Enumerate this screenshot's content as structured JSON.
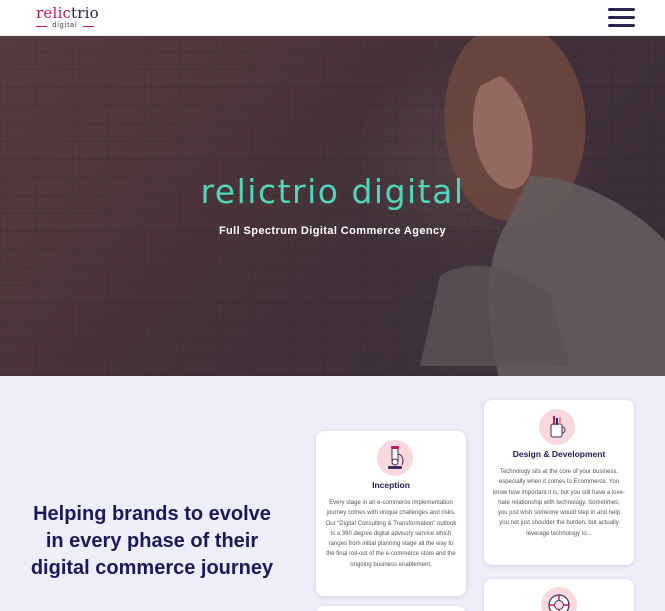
{
  "header": {
    "logo": {
      "word_part1": "relic",
      "word_part2": "trio",
      "sub": "digital"
    },
    "menu_icon": "hamburger-menu-icon"
  },
  "hero": {
    "title": "relictrio digital",
    "subtitle": "Full Spectrum Digital Commerce Agency"
  },
  "section": {
    "heading": "Helping brands to evolve in every phase of their digital commerce journey",
    "cards": [
      {
        "title": "Inception",
        "icon": "microscope-icon",
        "text": "Every stage in an e-commerce implementation journey comes with unique challenges and risks. Our “Digital Consulting & Transformation” outlook is a 360 degree digital advisory service which ranges from initial planning stage all the way to the final roll-out of the e-commerce store and the ongoing business enablement."
      },
      {
        "title": "Design & Development",
        "icon": "pencil-cup-icon",
        "text": "Technology sits at the core of your business, especially when it comes to Ecommerce. You know how important it is, but you still have a love-hate relationship with technology. Sometimes, you just wish someone would step in and help you not just shoulder the burden, but actually leverage technology to..."
      },
      {
        "title": "",
        "icon": "lifebuoy-icon",
        "text": ""
      }
    ]
  },
  "colors": {
    "accent": "#4fd6b8",
    "brand_navy": "#1c1a57",
    "brand_pink": "#c2185b",
    "section_bg": "#eeedfa"
  }
}
